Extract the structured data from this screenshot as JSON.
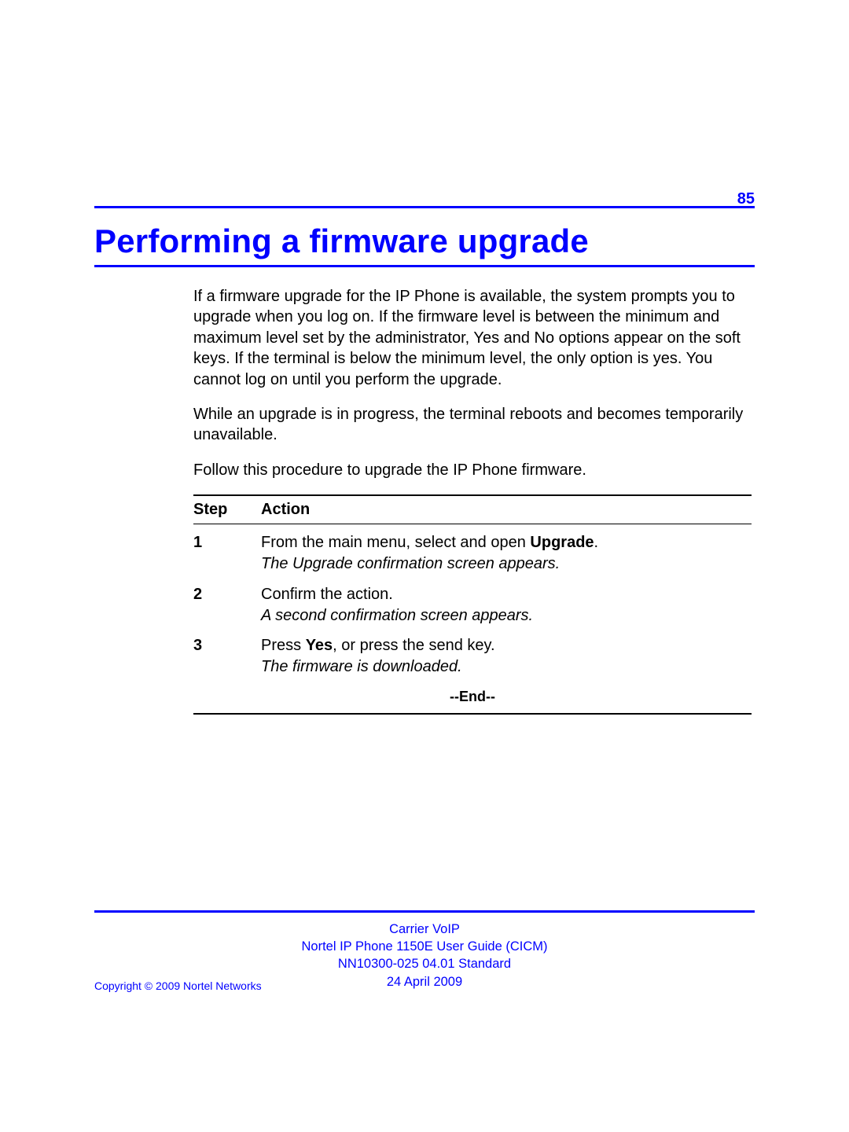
{
  "page_number": "85",
  "title": "Performing a firmware upgrade",
  "paragraphs": [
    "If a firmware upgrade for the IP Phone is available, the system prompts you to upgrade when you log on. If the firmware level is between the minimum and maximum level set by the administrator, Yes and No options appear on the soft keys. If the terminal is below the minimum level, the only option is yes. You cannot log on until you perform the upgrade.",
    "While an upgrade is in progress, the terminal reboots and becomes temporarily unavailable.",
    "Follow this procedure to upgrade the IP Phone firmware."
  ],
  "table": {
    "header_step": "Step",
    "header_action": "Action",
    "rows": [
      {
        "num": "1",
        "pre": "From the main menu, select and open ",
        "bold": "Upgrade",
        "post": ".",
        "result": "The Upgrade confirmation screen appears."
      },
      {
        "num": "2",
        "pre": "Confirm the action.",
        "bold": "",
        "post": "",
        "result": "A second confirmation screen appears."
      },
      {
        "num": "3",
        "pre": "Press ",
        "bold": "Yes",
        "post": ", or press the send key.",
        "result": "The firmware is downloaded."
      }
    ],
    "end_label": "--End--"
  },
  "footer": {
    "line1": "Carrier VoIP",
    "line2": "Nortel IP Phone 1150E User Guide (CICM)",
    "line3": "NN10300-025   04.01   Standard",
    "line4": "24 April 2009",
    "copyright": "Copyright © 2009 Nortel Networks"
  }
}
